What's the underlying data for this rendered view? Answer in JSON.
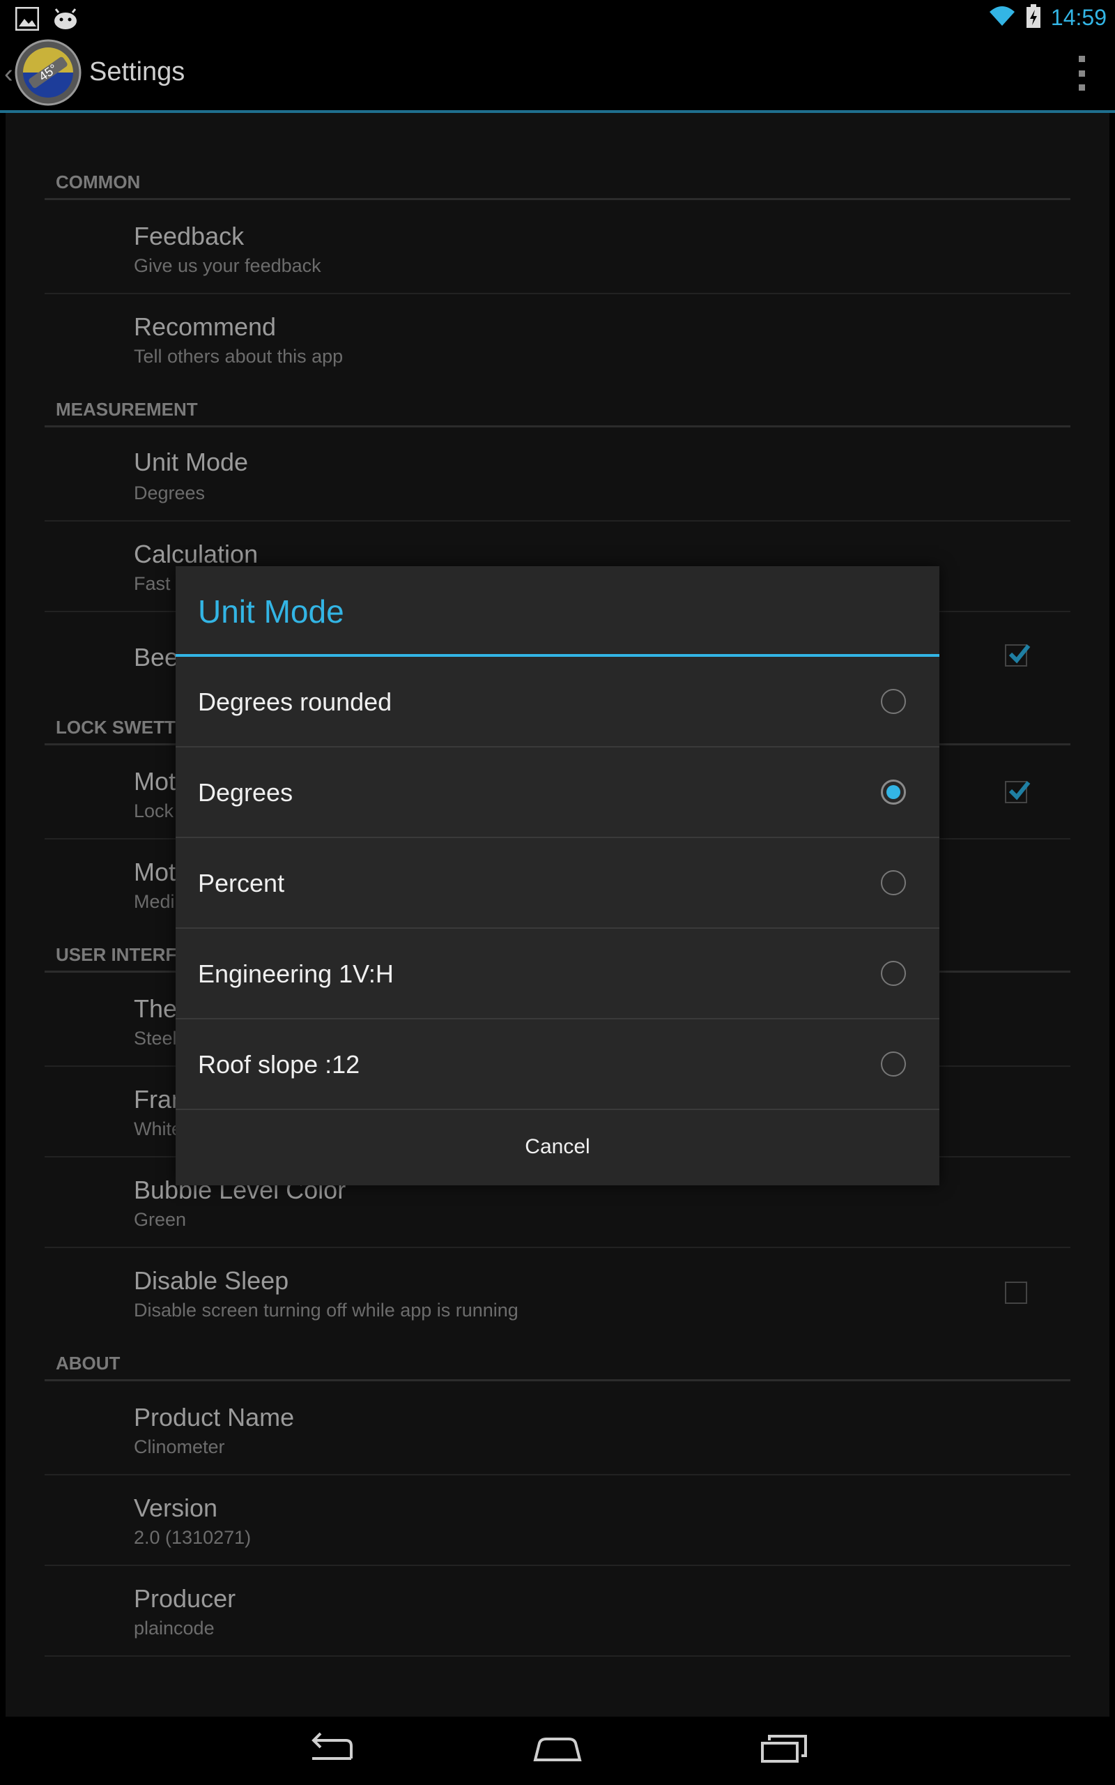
{
  "status_bar": {
    "time": "14:59"
  },
  "action_bar": {
    "title": "Settings"
  },
  "settings": {
    "common": {
      "header": "COMMON",
      "feedback": {
        "title": "Feedback",
        "summary": "Give us your feedback"
      },
      "recommend": {
        "title": "Recommend",
        "summary": "Tell others about this app"
      }
    },
    "measurement": {
      "header": "MEASUREMENT",
      "unit_mode": {
        "title": "Unit Mode",
        "summary": "Degrees"
      },
      "calculation": {
        "title": "Calculation",
        "summary": "Fast"
      },
      "beep": {
        "title_partial": "Bee"
      }
    },
    "lock": {
      "header_partial": "LOCK SWETT",
      "motion1": {
        "title_partial": "Mot",
        "summary_partial": "Lock"
      },
      "motion2": {
        "title_partial": "Mot",
        "summary_partial": "Medi"
      }
    },
    "ui": {
      "header_partial": "USER INTERF",
      "theme": {
        "title_partial": "The",
        "summary_partial": "Steel"
      },
      "frame": {
        "title_partial": "Fran",
        "summary_partial": "White"
      },
      "bubble": {
        "title": "Bubble Level Color",
        "summary": "Green"
      },
      "disable_sleep": {
        "title": "Disable Sleep",
        "summary": "Disable screen turning off while app is running"
      }
    },
    "about": {
      "header": "ABOUT",
      "product": {
        "title": "Product Name",
        "summary": "Clinometer"
      },
      "version": {
        "title": "Version",
        "summary": "2.0 (1310271)"
      },
      "producer": {
        "title": "Producer",
        "summary": "plaincode"
      }
    }
  },
  "dialog": {
    "title": "Unit Mode",
    "options": [
      {
        "label": "Degrees rounded",
        "selected": false
      },
      {
        "label": "Degrees",
        "selected": true
      },
      {
        "label": "Percent",
        "selected": false
      },
      {
        "label": "Engineering 1V:H",
        "selected": false
      },
      {
        "label": "Roof slope :12",
        "selected": false
      }
    ],
    "cancel_label": "Cancel"
  },
  "colors": {
    "accent": "#33b5e5",
    "background": "#111111",
    "dialog_bg": "#282828"
  },
  "icons": [
    "gallery-icon",
    "android-icon",
    "wifi-icon",
    "battery-charging-icon",
    "app-icon",
    "overflow-menu-icon",
    "back-nav-icon",
    "home-nav-icon",
    "recents-nav-icon",
    "checkbox-checked-icon",
    "checkbox-unchecked-icon"
  ]
}
